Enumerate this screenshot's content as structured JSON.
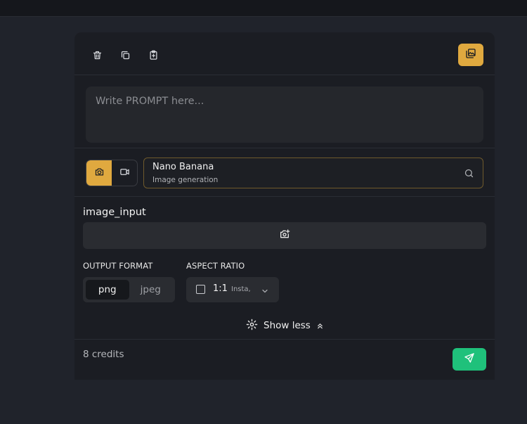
{
  "toolbar": {
    "icons": [
      "trash-icon",
      "copy-icon",
      "clipboard-paste-icon",
      "gallery-icon"
    ],
    "accent": "#e0a93f"
  },
  "prompt": {
    "placeholder": "Write PROMPT here..."
  },
  "mode": {
    "options": [
      "camera-icon",
      "video-icon"
    ],
    "selected": "image"
  },
  "model": {
    "name": "Nano Banana",
    "subtitle": "Image generation"
  },
  "image_input": {
    "label": "image_input"
  },
  "output_format": {
    "label": "OUTPUT FORMAT",
    "options": [
      "png",
      "jpeg"
    ],
    "selected": "png"
  },
  "aspect_ratio": {
    "label": "ASPECT RATIO",
    "value": "1:1",
    "subtitle": "Insta,"
  },
  "toggle": {
    "label": "Show less"
  },
  "footer": {
    "credits": "8 credits",
    "send_color": "#1fc17b"
  }
}
